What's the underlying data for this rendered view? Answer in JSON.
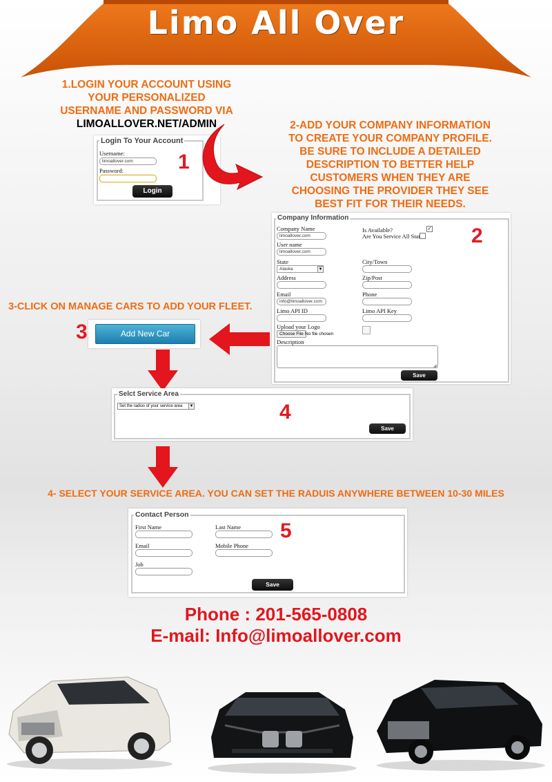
{
  "header": {
    "title": "Limo All Over",
    "banner_color": "#e0680e"
  },
  "step1": {
    "text_lines": [
      "1.LOGIN YOUR ACCOUNT USING",
      "YOUR PERSONALIZED",
      "USERNAME AND PASSWORD VIA"
    ],
    "url": "LIMOALLOVER.NET/ADMIN",
    "number": "1",
    "login_panel": {
      "legend": "Login To Your Account",
      "username_label": "Username:",
      "username_value": "limoallover.com",
      "password_label": "Password:",
      "password_value": "",
      "button": "Login"
    }
  },
  "step2": {
    "text_lines": [
      "2-ADD YOUR COMPANY INFORMATION",
      "TO CREATE YOUR COMPANY PROFILE.",
      "BE SURE TO INCLUDE A DETAILED",
      "DESCRIPTION TO BETTER HELP",
      "CUSTOMERS WHEN THEY ARE",
      "CHOOSING THE PROVIDER THEY SEE",
      "BEST FIT FOR THEIR NEEDS."
    ],
    "number": "2",
    "company_panel": {
      "legend": "Company Information",
      "company_name_label": "Company Name",
      "company_name_value": "limoallover.com",
      "user_name_label": "User name",
      "user_name_value": "limoallover.com",
      "state_label": "State",
      "state_value": "Alaska",
      "address_label": "Address",
      "email_label": "Email",
      "email_value": "info@limoallover.com",
      "limo_api_id_label": "Limo API ID",
      "upload_logo_label": "Upload your Logo",
      "choose_file_button": "Choose File",
      "no_file_text": "No file chosen",
      "description_label": "Description",
      "is_available_label": "Is Available?",
      "is_available_checked": true,
      "all_state_label": "Are You Service  All State?",
      "all_state_checked": false,
      "city_label": "City/Town",
      "zip_label": "Zip/Post",
      "phone_label": "Phone",
      "limo_api_key_label": "Limo API Key",
      "save_button": "Save"
    }
  },
  "step3": {
    "text": "3-CLICK ON MANAGE CARS TO ADD YOUR FLEET.",
    "number": "3",
    "add_car_button": "Add New Car"
  },
  "step4": {
    "number": "4",
    "service_panel": {
      "legend": "Selct Service Area",
      "select_value": "Set the radius of your service area",
      "save_button": "Save"
    },
    "text": "4- SELECT YOUR SERVICE AREA. YOU CAN SET THE RADUIS ANYWHERE BETWEEN 10-30 MILES"
  },
  "step5": {
    "number": "5",
    "contact_panel": {
      "legend": "Contact Person",
      "first_name_label": "First Name",
      "last_name_label": "Last Name",
      "email_label": "Email",
      "mobile_label": "Mobile Phone",
      "job_label": "Job",
      "save_button": "Save"
    }
  },
  "contact": {
    "phone": "Phone : 201-565-0808",
    "email": "E-mail: Info@limoallover.com"
  },
  "icons": [
    "curved-arrow-icon",
    "right-arrow-icon",
    "left-arrow-icon",
    "down-arrow-icon",
    "checkbox-icon",
    "select-caret-icon",
    "resize-grip-icon"
  ]
}
